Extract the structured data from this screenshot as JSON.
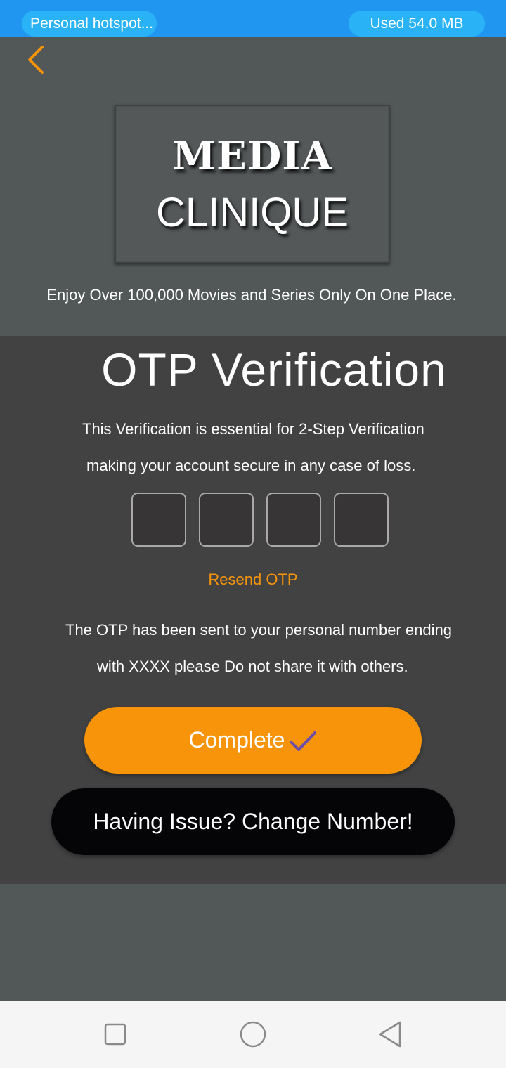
{
  "status_bar": {
    "hotspot_label": "Personal hotspot...",
    "usage_label": "Used  54.0 MB"
  },
  "header": {
    "logo": {
      "line1": "MEDIA",
      "line2": "CLINIQUE"
    },
    "tagline": "Enjoy Over 100,000 Movies and Series Only On One Place."
  },
  "otp": {
    "title": "OTP Verification",
    "description_line1": "This Verification is essential for 2-Step Verification",
    "description_line2": "making your account secure in any case of loss.",
    "digits": [
      "",
      "",
      "",
      ""
    ],
    "resend_label": "Resend OTP",
    "info_line1": "The OTP has been sent to your personal number ending",
    "info_line2": "with XXXX please Do not share it with others."
  },
  "actions": {
    "complete_label": "Complete",
    "change_number_label": "Having Issue? Change Number!"
  },
  "icons": {
    "back": "chevron-left-icon",
    "complete": "check-icon",
    "nav": [
      "square-icon",
      "circle-icon",
      "triangle-back-icon"
    ]
  },
  "colors": {
    "accent": "#f7940a",
    "status_bar": "#2196f0",
    "pill": "#29b3f6",
    "background": "#525757",
    "card": "#424242",
    "secondary_button": "#050508",
    "check": "#6b4fa6"
  }
}
